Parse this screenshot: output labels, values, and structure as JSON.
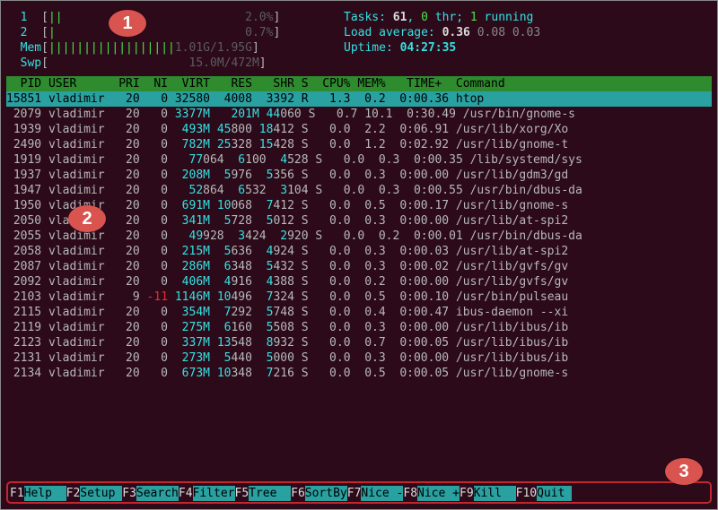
{
  "meters": {
    "cpu1": {
      "label": "1",
      "bars": "||",
      "value": "2.0%"
    },
    "cpu2": {
      "label": "2",
      "bars": "|",
      "value": "0.7%"
    },
    "mem": {
      "label": "Mem",
      "bars": "||||||||||||||||||",
      "value": "1.01G/1.95G"
    },
    "swp": {
      "label": "Swp",
      "bars": "",
      "value": "15.0M/472M"
    }
  },
  "info": {
    "tasksLabel": "Tasks: ",
    "tasks": "61",
    "thr": "0",
    "thrLabel": " thr; ",
    "running": "1",
    "runningLabel": " running",
    "loadLabel": "Load average: ",
    "la1": "0.36",
    "la2": "0.08",
    "la3": "0.03",
    "uptimeLabel": "Uptime: ",
    "uptime": "04:27:35"
  },
  "header": "  PID USER      PRI  NI  VIRT   RES   SHR S  CPU% MEM%   TIME+  Command         ",
  "selected": {
    "pid": "15851",
    "user": "vladimir",
    "pri": "20",
    "ni": "0",
    "virt": "32580",
    "res": "4008",
    "shr": "3392",
    "s": "R",
    "cpu": "1.3",
    "mem": "0.2",
    "time": "0:00.36",
    "cmd": "htop"
  },
  "rows": [
    {
      "pid": "2079",
      "user": "vladimir",
      "pri": "20",
      "ni": "0",
      "virtA": "3377",
      "virtB": "M",
      "res": "  201",
      "resB": "M",
      "shrA": "44",
      "shrB": "060",
      "s": "S",
      "cpu": "0.7",
      "mem": "10.1",
      "time": "0:30.49",
      "cmd": "/usr/bin/gnome-s"
    },
    {
      "pid": "1939",
      "user": "vladimir",
      "pri": "20",
      "ni": "0",
      "virtA": " 493",
      "virtB": "M",
      "res": "45",
      "resB": "800",
      "shrA": "18",
      "shrB": "412",
      "s": "S",
      "cpu": "0.0",
      "mem": "2.2",
      "time": "0:06.91",
      "cmd": "/usr/lib/xorg/Xo"
    },
    {
      "pid": "2490",
      "user": "vladimir",
      "pri": "20",
      "ni": "0",
      "virtA": " 782",
      "virtB": "M",
      "res": "25",
      "resB": "328",
      "shrA": "15",
      "shrB": "428",
      "s": "S",
      "cpu": "0.0",
      "mem": "1.2",
      "time": "0:02.92",
      "cmd": "/usr/lib/gnome-t"
    },
    {
      "pid": "1919",
      "user": "vladimir",
      "pri": "20",
      "ni": "0",
      "virtA": "77",
      "virtB": "064",
      "res": " 6",
      "resB": "100",
      "shrA": " 4",
      "shrB": "528",
      "s": "S",
      "cpu": "0.0",
      "mem": "0.3",
      "time": "0:00.35",
      "cmd": "/lib/systemd/sys"
    },
    {
      "pid": "1937",
      "user": "vladimir",
      "pri": "20",
      "ni": "0",
      "virtA": " 208",
      "virtB": "M",
      "res": " 5",
      "resB": "976",
      "shrA": " 5",
      "shrB": "356",
      "s": "S",
      "cpu": "0.0",
      "mem": "0.3",
      "time": "0:00.00",
      "cmd": "/usr/lib/gdm3/gd"
    },
    {
      "pid": "1947",
      "user": "vladimir",
      "pri": "20",
      "ni": "0",
      "virtA": "52",
      "virtB": "864",
      "res": " 6",
      "resB": "532",
      "shrA": " 3",
      "shrB": "104",
      "s": "S",
      "cpu": "0.0",
      "mem": "0.3",
      "time": "0:00.55",
      "cmd": "/usr/bin/dbus-da"
    },
    {
      "pid": "1950",
      "user": "vladimir",
      "pri": "20",
      "ni": "0",
      "virtA": " 691",
      "virtB": "M",
      "res": "10",
      "resB": "068",
      "shrA": " 7",
      "shrB": "412",
      "s": "S",
      "cpu": "0.0",
      "mem": "0.5",
      "time": "0:00.17",
      "cmd": "/usr/lib/gnome-s"
    },
    {
      "pid": "2050",
      "user": "vladimir",
      "pri": "20",
      "ni": "0",
      "virtA": " 341",
      "virtB": "M",
      "res": " 5",
      "resB": "728",
      "shrA": " 5",
      "shrB": "012",
      "s": "S",
      "cpu": "0.0",
      "mem": "0.3",
      "time": "0:00.00",
      "cmd": "/usr/lib/at-spi2"
    },
    {
      "pid": "2055",
      "user": "vladimir",
      "pri": "20",
      "ni": "0",
      "virtA": "49",
      "virtB": "928",
      "res": " 3",
      "resB": "424",
      "shrA": " 2",
      "shrB": "920",
      "s": "S",
      "cpu": "0.0",
      "mem": "0.2",
      "time": "0:00.01",
      "cmd": "/usr/bin/dbus-da"
    },
    {
      "pid": "2058",
      "user": "vladimir",
      "pri": "20",
      "ni": "0",
      "virtA": " 215",
      "virtB": "M",
      "res": " 5",
      "resB": "636",
      "shrA": " 4",
      "shrB": "924",
      "s": "S",
      "cpu": "0.0",
      "mem": "0.3",
      "time": "0:00.03",
      "cmd": "/usr/lib/at-spi2"
    },
    {
      "pid": "2087",
      "user": "vladimir",
      "pri": "20",
      "ni": "0",
      "virtA": " 286",
      "virtB": "M",
      "res": " 6",
      "resB": "348",
      "shrA": " 5",
      "shrB": "432",
      "s": "S",
      "cpu": "0.0",
      "mem": "0.3",
      "time": "0:00.02",
      "cmd": "/usr/lib/gvfs/gv"
    },
    {
      "pid": "2092",
      "user": "vladimir",
      "pri": "20",
      "ni": "0",
      "virtA": " 406",
      "virtB": "M",
      "res": " 4",
      "resB": "916",
      "shrA": " 4",
      "shrB": "388",
      "s": "S",
      "cpu": "0.0",
      "mem": "0.2",
      "time": "0:00.00",
      "cmd": "/usr/lib/gvfs/gv"
    },
    {
      "pid": "2103",
      "user": "vladimir",
      "pri": "9",
      "ni": "-11",
      "virtA": "1146",
      "virtB": "M",
      "res": "10",
      "resB": "496",
      "shrA": " 7",
      "shrB": "324",
      "s": "S",
      "cpu": "0.0",
      "mem": "0.5",
      "time": "0:00.10",
      "cmd": "/usr/bin/pulseau"
    },
    {
      "pid": "2115",
      "user": "vladimir",
      "pri": "20",
      "ni": "0",
      "virtA": " 354",
      "virtB": "M",
      "res": " 7",
      "resB": "292",
      "shrA": " 5",
      "shrB": "748",
      "s": "S",
      "cpu": "0.0",
      "mem": "0.4",
      "time": "0:00.47",
      "cmd": "ibus-daemon --xi"
    },
    {
      "pid": "2119",
      "user": "vladimir",
      "pri": "20",
      "ni": "0",
      "virtA": " 275",
      "virtB": "M",
      "res": " 6",
      "resB": "160",
      "shrA": " 5",
      "shrB": "508",
      "s": "S",
      "cpu": "0.0",
      "mem": "0.3",
      "time": "0:00.00",
      "cmd": "/usr/lib/ibus/ib"
    },
    {
      "pid": "2123",
      "user": "vladimir",
      "pri": "20",
      "ni": "0",
      "virtA": " 337",
      "virtB": "M",
      "res": "13",
      "resB": "548",
      "shrA": " 8",
      "shrB": "932",
      "s": "S",
      "cpu": "0.0",
      "mem": "0.7",
      "time": "0:00.05",
      "cmd": "/usr/lib/ibus/ib"
    },
    {
      "pid": "2131",
      "user": "vladimir",
      "pri": "20",
      "ni": "0",
      "virtA": " 273",
      "virtB": "M",
      "res": " 5",
      "resB": "440",
      "shrA": " 5",
      "shrB": "000",
      "s": "S",
      "cpu": "0.0",
      "mem": "0.3",
      "time": "0:00.00",
      "cmd": "/usr/lib/ibus/ib"
    },
    {
      "pid": "2134",
      "user": "vladimir",
      "pri": "20",
      "ni": "0",
      "virtA": " 673",
      "virtB": "M",
      "res": "10",
      "resB": "348",
      "shrA": " 7",
      "shrB": "216",
      "s": "S",
      "cpu": "0.0",
      "mem": "0.5",
      "time": "0:00.05",
      "cmd": "/usr/lib/gnome-s"
    }
  ],
  "footer": [
    {
      "key": "F1",
      "label": "Help  "
    },
    {
      "key": "F2",
      "label": "Setup "
    },
    {
      "key": "F3",
      "label": "Search"
    },
    {
      "key": "F4",
      "label": "Filter"
    },
    {
      "key": "F5",
      "label": "Tree  "
    },
    {
      "key": "F6",
      "label": "SortBy"
    },
    {
      "key": "F7",
      "label": "Nice -"
    },
    {
      "key": "F8",
      "label": "Nice +"
    },
    {
      "key": "F9",
      "label": "Kill  "
    },
    {
      "key": "F10",
      "label": "Quit "
    }
  ],
  "callouts": {
    "c1": "1",
    "c2": "2",
    "c3": "3"
  }
}
